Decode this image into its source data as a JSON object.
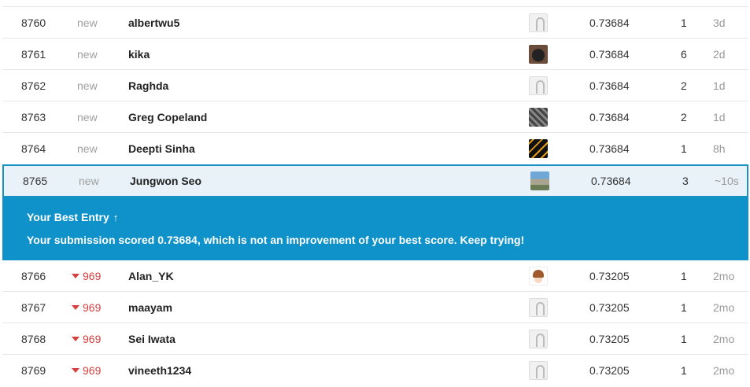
{
  "rows_above": [
    {
      "rank": "8760",
      "change": "new",
      "name": "albertwu5",
      "avatar": "default-avatar",
      "score": "0.73684",
      "entries": "1",
      "last": "3d"
    },
    {
      "rank": "8761",
      "change": "new",
      "name": "kika",
      "avatar": "dark-avatar",
      "score": "0.73684",
      "entries": "6",
      "last": "2d"
    },
    {
      "rank": "8762",
      "change": "new",
      "name": "Raghda",
      "avatar": "default-avatar",
      "score": "0.73684",
      "entries": "2",
      "last": "1d"
    },
    {
      "rank": "8763",
      "change": "new",
      "name": "Greg Copeland",
      "avatar": "gray-avatar",
      "score": "0.73684",
      "entries": "2",
      "last": "1d"
    },
    {
      "rank": "8764",
      "change": "new",
      "name": "Deepti Sinha",
      "avatar": "orange-avatar",
      "score": "0.73684",
      "entries": "1",
      "last": "8h"
    }
  ],
  "selected_row": {
    "rank": "8765",
    "change": "new",
    "name": "Jungwon Seo",
    "avatar": "photo-avatar",
    "score": "0.73684",
    "entries": "3",
    "last": "~10s"
  },
  "banner": {
    "title": "Your Best Entry",
    "arrow": "↑",
    "message": "Your submission scored 0.73684, which is not an improvement of your best score. Keep trying!",
    "color": "#0f92c9"
  },
  "rows_below": [
    {
      "rank": "8766",
      "change": "969",
      "name": "Alan_YK",
      "avatar": "anime-avatar",
      "score": "0.73205",
      "entries": "1",
      "last": "2mo"
    },
    {
      "rank": "8767",
      "change": "969",
      "name": "maayam",
      "avatar": "default-avatar",
      "score": "0.73205",
      "entries": "1",
      "last": "2mo"
    },
    {
      "rank": "8768",
      "change": "969",
      "name": "Sei Iwata",
      "avatar": "default-avatar",
      "score": "0.73205",
      "entries": "1",
      "last": "2mo"
    },
    {
      "rank": "8769",
      "change": "969",
      "name": "vineeth1234",
      "avatar": "default-avatar",
      "score": "0.73205",
      "entries": "1",
      "last": "2mo"
    }
  ],
  "colors": {
    "down": "#d63f3f",
    "selected_border": "#1791c4",
    "selected_bg": "#e8f2f8"
  }
}
